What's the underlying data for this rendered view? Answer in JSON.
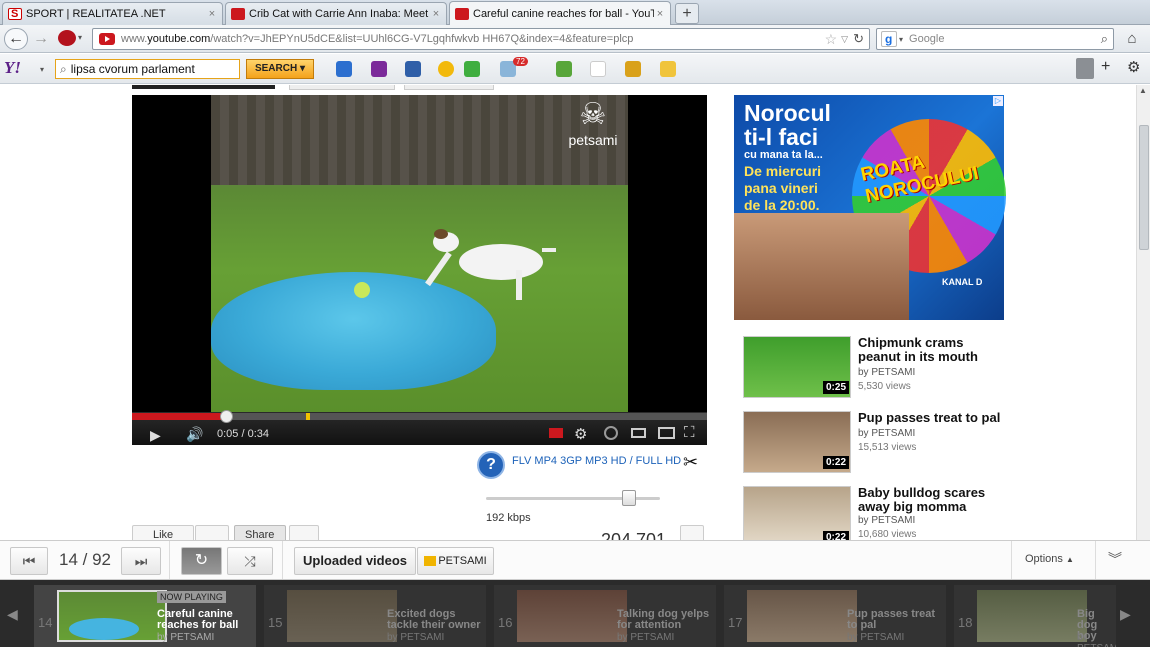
{
  "tabs": [
    {
      "title": "SPORT | REALITATEA .NET",
      "close": "×"
    },
    {
      "title": "Crib Cat with Carrie Ann Inaba: Meet Bliz...",
      "close": "×"
    },
    {
      "title": "Careful canine reaches for ball - YouTube",
      "close": "×"
    }
  ],
  "new_tab": "+",
  "address": {
    "url_prefix": "www.",
    "url_domain": "youtube.com",
    "url_rest": "/watch?v=JhEPYnU5dCE&list=UUhl6CG-V7Lgqhfwkvb HH67Q&index=4&feature=plcp"
  },
  "search_engine": {
    "placeholder": "Google"
  },
  "yahoo_toolbar": {
    "logo": "Y!",
    "query": "lipsa cvorum parlament",
    "search_label": "SEARCH",
    "mail_badge": "72"
  },
  "player": {
    "watermark": "petsami",
    "time_current": "0:05",
    "time_sep": "/",
    "time_total": "0:34",
    "progress_fraction": 0.164
  },
  "download_bar": {
    "formats": "FLV MP4 3GP MP3 HD / FULL HD",
    "bitrate": "192 kbps"
  },
  "below_player": {
    "like_label": "Like",
    "share_label": "Share",
    "view_count": "204,701"
  },
  "side_ad": {
    "headline1": "Norocul",
    "headline2": "ti-l faci",
    "headline3": "cu mana ta la...",
    "sub1": "De miercuri",
    "sub2": "pana vineri",
    "sub3": "de la 20:00.",
    "show": "ROATA NOROCULUI",
    "channel": "KANAL D"
  },
  "related": [
    {
      "title": "Chipmunk crams peanut in its mouth",
      "by": "by PETSAMI",
      "views": "5,530 views",
      "duration": "0:25"
    },
    {
      "title": "Pup passes treat to pal",
      "by": "by PETSAMI",
      "views": "15,513 views",
      "duration": "0:22"
    },
    {
      "title": "Baby bulldog scares away big momma",
      "by": "by PETSAMI",
      "views": "10,680 views",
      "duration": "0:22"
    }
  ],
  "playlist": {
    "position": "14 / 92",
    "source_label": "Uploaded videos",
    "channel": "PETSAMI",
    "options_label": "Options",
    "items": [
      {
        "num": "14",
        "title": "Careful canine reaches for ball",
        "by": "by PETSAMI",
        "now_playing": "NOW PLAYING"
      },
      {
        "num": "15",
        "title": "Excited dogs tackle their owner",
        "by": "by PETSAMI"
      },
      {
        "num": "16",
        "title": "Talking dog yelps for attention",
        "by": "by PETSAMI"
      },
      {
        "num": "17",
        "title": "Pup passes treat to pal",
        "by": "by PETSAMI"
      },
      {
        "num": "18",
        "title": "Big dog boy",
        "by": "by PETSAMI"
      }
    ]
  },
  "colors": {
    "youtube_red": "#cc181e",
    "yahoo_purple": "#5b1f87",
    "link_blue": "#1c62b9"
  }
}
